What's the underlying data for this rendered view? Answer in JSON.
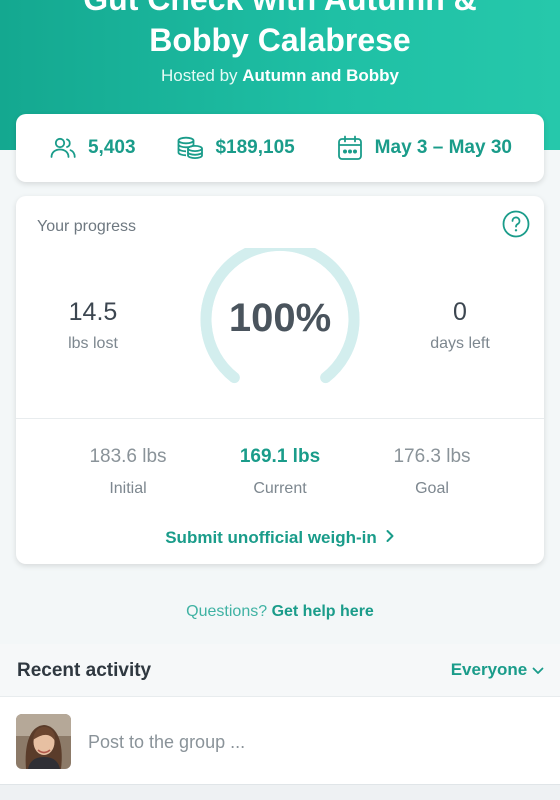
{
  "hero": {
    "title_line1": "Gut Check with Autumn &",
    "title_line2": "Bobby Calabrese",
    "hosted_prefix": "Hosted by ",
    "hosts": "Autumn and Bobby"
  },
  "stats": {
    "participants": "5,403",
    "pot": "$189,105",
    "dates": "May 3 – May 30",
    "icons": [
      "people-icon",
      "coins-icon",
      "calendar-icon"
    ],
    "accent": "#1a9c8a"
  },
  "progress": {
    "label": "Your progress",
    "lbs_lost": "14.5",
    "lbs_lost_caption": "lbs lost",
    "percent_text": "100%",
    "percent": 100,
    "days_left": "0",
    "days_left_caption": "days left",
    "initial_value": "183.6 lbs",
    "initial_label": "Initial",
    "current_value": "169.1 lbs",
    "current_label": "Current",
    "goal_value": "176.3 lbs",
    "goal_label": "Goal",
    "weigh_in_link": "Submit unofficial weigh-in",
    "ring_color": "#d3eeee"
  },
  "help": {
    "prefix": "Questions? ",
    "link": "Get help here"
  },
  "activity": {
    "title": "Recent activity",
    "filter": "Everyone",
    "post_placeholder": "Post to the group ..."
  }
}
